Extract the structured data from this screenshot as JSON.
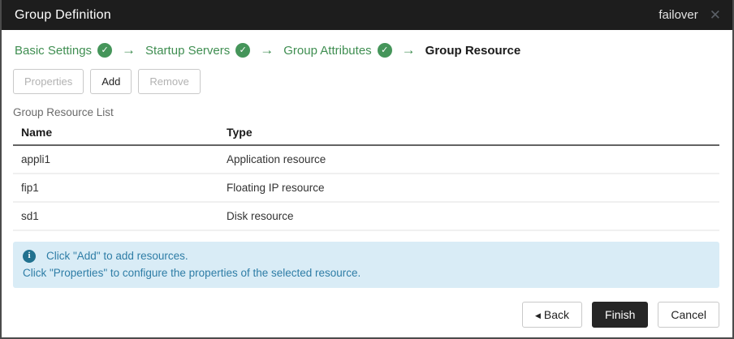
{
  "dialog": {
    "title": "Group Definition",
    "context_label": "failover",
    "close_glyph": "✕"
  },
  "wizard": {
    "arrow_glyph": "→",
    "check_glyph": "✓",
    "steps": [
      {
        "label": "Basic Settings",
        "completed": true
      },
      {
        "label": "Startup Servers",
        "completed": true
      },
      {
        "label": "Group Attributes",
        "completed": true
      },
      {
        "label": "Group Resource",
        "completed": false,
        "active": true
      }
    ]
  },
  "toolbar": {
    "properties_label": "Properties",
    "add_label": "Add",
    "remove_label": "Remove",
    "properties_enabled": false,
    "add_enabled": true,
    "remove_enabled": false
  },
  "list": {
    "caption": "Group Resource List",
    "columns": [
      "Name",
      "Type"
    ],
    "rows": [
      {
        "name": "appli1",
        "type": "Application resource"
      },
      {
        "name": "fip1",
        "type": "Floating IP resource"
      },
      {
        "name": "sd1",
        "type": "Disk resource"
      }
    ]
  },
  "info": {
    "icon_glyph": "i",
    "line1": "Click \"Add\" to add resources.",
    "line2": "Click \"Properties\" to configure the properties of the selected resource."
  },
  "footer": {
    "back_arrow_glyph": "◀",
    "back_label": "Back",
    "finish_label": "Finish",
    "cancel_label": "Cancel"
  },
  "colors": {
    "titlebar_bg": "#1d1d1d",
    "accent_green": "#3f8e51",
    "check_circle": "#45955a",
    "info_bg": "#d9ecf6",
    "info_text": "#2e7da6",
    "info_icon_bg": "#21718f",
    "finish_button_bg": "#262626",
    "header_rule": "#636363",
    "row_divider": "#f0f0f0"
  }
}
